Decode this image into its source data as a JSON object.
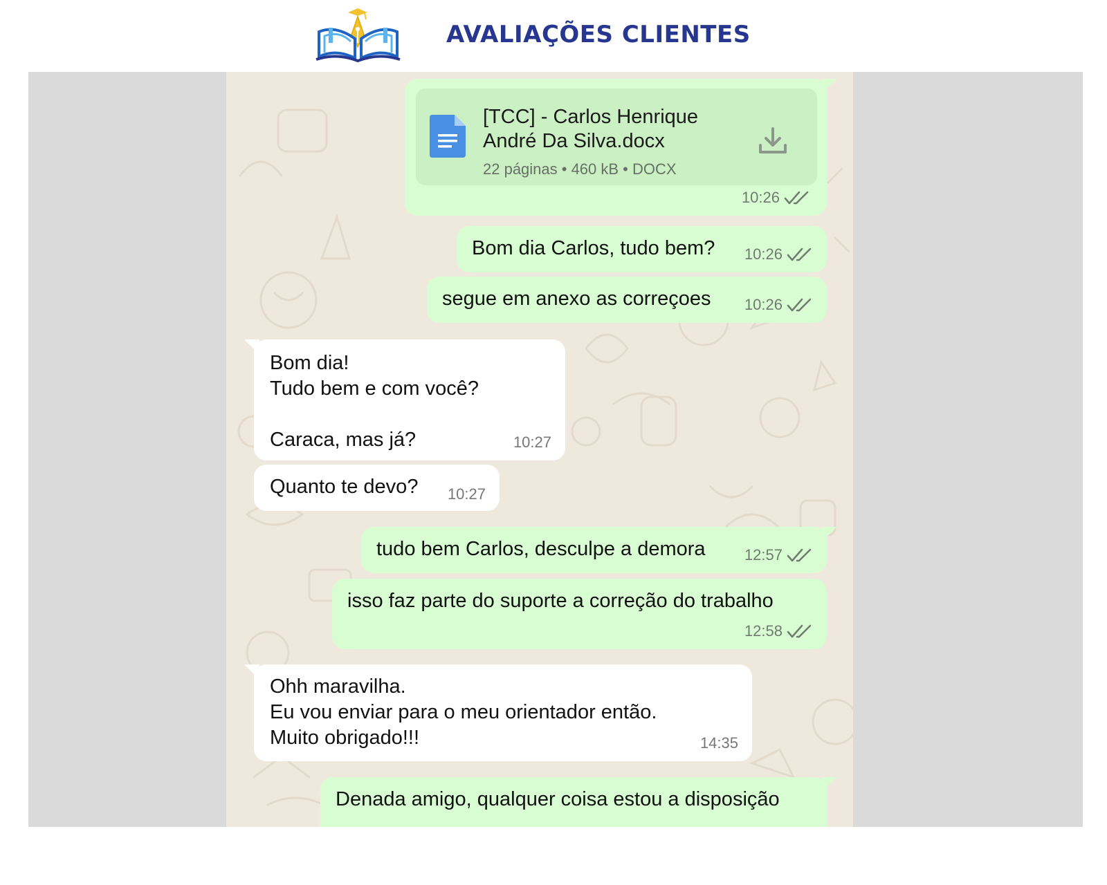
{
  "header": {
    "title": "AVALIAÇÕES CLIENTES",
    "logo_icon": "open-book-graduation-cap-pen-icon"
  },
  "colors": {
    "title": "#27378f",
    "outgoing_bubble": "#d9fdd3",
    "incoming_bubble": "#ffffff",
    "chat_background": "#efe8dd",
    "side_band": "#dadada",
    "read_ticks": "#6f7b6f"
  },
  "chat": {
    "messages": [
      {
        "direction": "outgoing",
        "type": "document",
        "file_name": "[TCC] - Carlos Henrique\nAndré Da Silva.docx",
        "file_info": "22 páginas • 460 kB • DOCX",
        "file_icon": "document-icon",
        "action_icon": "download-icon",
        "time": "10:26",
        "status_icon": "double-check-icon"
      },
      {
        "direction": "outgoing",
        "text": "Bom dia Carlos, tudo bem?",
        "time": "10:26",
        "status_icon": "double-check-icon"
      },
      {
        "direction": "outgoing",
        "text": "segue em anexo as correçoes",
        "time": "10:26",
        "status_icon": "double-check-icon"
      },
      {
        "direction": "incoming",
        "text": "Bom dia!\nTudo bem e com você?\n\nCaraca, mas já?",
        "time": "10:27"
      },
      {
        "direction": "incoming",
        "text": "Quanto te devo?",
        "time": "10:27"
      },
      {
        "direction": "outgoing",
        "text": "tudo bem Carlos, desculpe a demora",
        "time": "12:57",
        "status_icon": "double-check-icon"
      },
      {
        "direction": "outgoing",
        "text": "isso faz parte do suporte a correção do trabalho",
        "time": "12:58",
        "status_icon": "double-check-icon"
      },
      {
        "direction": "incoming",
        "text": "Ohh maravilha.\nEu vou enviar para o meu orientador então.\nMuito obrigado!!!",
        "time": "14:35"
      },
      {
        "direction": "outgoing",
        "text": "Denada amigo, qualquer coisa estou a disposição"
      }
    ]
  }
}
